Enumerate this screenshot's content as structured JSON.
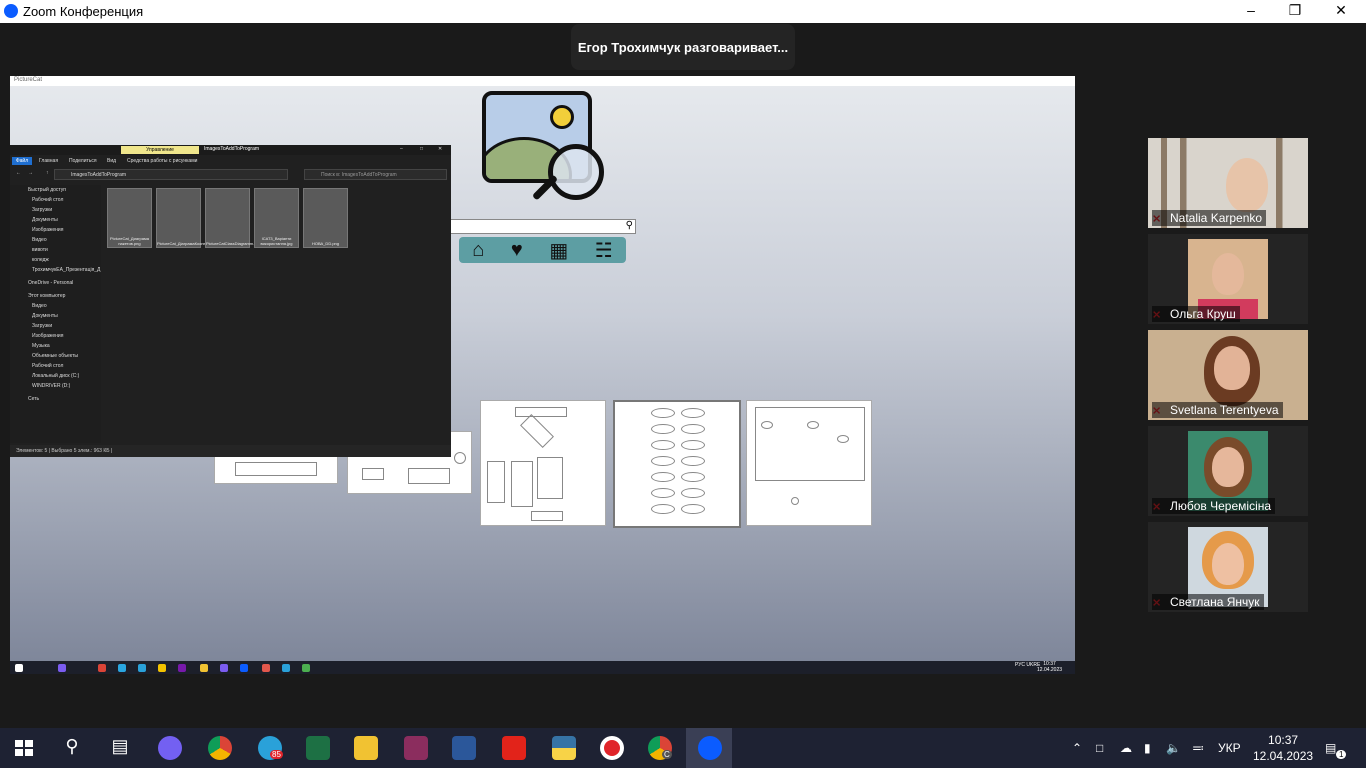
{
  "window": {
    "title": "Zoom Конференция"
  },
  "speaking_banner": "Егор Трохимчук разговаривает...",
  "shared": {
    "app_title": "PictureCat",
    "navbar_icons": [
      "home-icon",
      "heart-icon",
      "grid-icon",
      "basket-icon"
    ],
    "explorer": {
      "ribbon_manage": "Управление",
      "folder_name": "ImagesToAddToProgram",
      "menu": [
        "Файл",
        "Главная",
        "Поделиться",
        "Вид",
        "Средства работы с рисунками"
      ],
      "address": "ImagesToAddToProgram",
      "search_placeholder": "Поиск в: ImagesToAddToProgram",
      "sidebar": [
        "Быстрый доступ",
        "Рабочий стол",
        "Загрузки",
        "Документы",
        "Изображения",
        "Видео",
        "вивоти",
        "коледж",
        "ТрохимчукЕА_Презентація_Д",
        "OneDrive - Personal",
        "Этот компьютер",
        "Видео",
        "Документы",
        "Загрузки",
        "Изображения",
        "Музыка",
        "Объемные объекты",
        "Рабочий стол",
        "Локальный диск (C:)",
        "WINDRIVER (D:)",
        "Сеть"
      ],
      "files": [
        "PictureCat_Диаграма пакетов.png",
        "PictureCat_ДіаграмаКооперації.png",
        "PictureCatClassDiagramm.png",
        "ICAT3_Варіанти використання.jpg",
        "НОВА_DD.png"
      ],
      "status": "Элементов: 5  |  Выбрано 5 элем.: 963 КБ  |"
    },
    "inner_clock": {
      "time": "10:37",
      "date": "12.04.2023",
      "lang": "РУС UKRE"
    }
  },
  "participants": [
    {
      "name": "Natalia Karpenko",
      "muted": true
    },
    {
      "name": "Ольга Круш",
      "muted": true
    },
    {
      "name": "Svetlana Terentyeva",
      "muted": true
    },
    {
      "name": "Любов Черемісіна",
      "muted": true
    },
    {
      "name": "Светлана Янчук",
      "muted": true
    }
  ],
  "taskbar": {
    "telegram_badge": "85",
    "chrome_badge": "C",
    "lang": "УКР",
    "time": "10:37",
    "date": "12.04.2023",
    "notifications": "1"
  },
  "colors": {
    "navbar": "#5d9ea3",
    "zoom_blue": "#0b5cff",
    "mute_red": "#e0242a"
  }
}
